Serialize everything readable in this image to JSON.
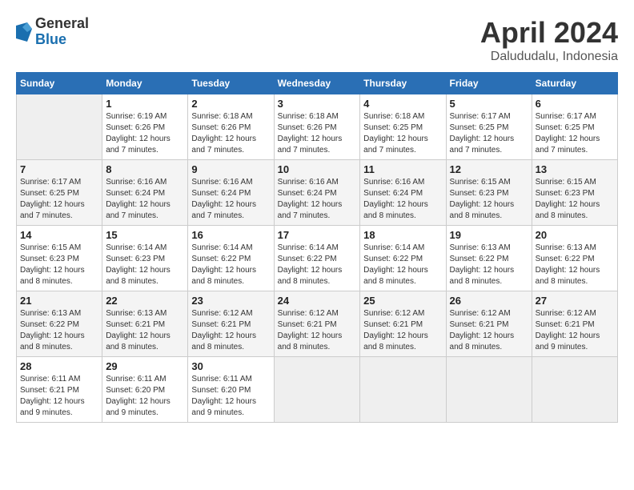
{
  "header": {
    "logo_general": "General",
    "logo_blue": "Blue",
    "title": "April 2024",
    "location": "Dalududalu, Indonesia"
  },
  "columns": [
    "Sunday",
    "Monday",
    "Tuesday",
    "Wednesday",
    "Thursday",
    "Friday",
    "Saturday"
  ],
  "weeks": [
    [
      {
        "day": "",
        "empty": true
      },
      {
        "day": "1",
        "sunrise": "6:19 AM",
        "sunset": "6:26 PM",
        "daylight": "12 hours and 7 minutes."
      },
      {
        "day": "2",
        "sunrise": "6:18 AM",
        "sunset": "6:26 PM",
        "daylight": "12 hours and 7 minutes."
      },
      {
        "day": "3",
        "sunrise": "6:18 AM",
        "sunset": "6:26 PM",
        "daylight": "12 hours and 7 minutes."
      },
      {
        "day": "4",
        "sunrise": "6:18 AM",
        "sunset": "6:25 PM",
        "daylight": "12 hours and 7 minutes."
      },
      {
        "day": "5",
        "sunrise": "6:17 AM",
        "sunset": "6:25 PM",
        "daylight": "12 hours and 7 minutes."
      },
      {
        "day": "6",
        "sunrise": "6:17 AM",
        "sunset": "6:25 PM",
        "daylight": "12 hours and 7 minutes."
      }
    ],
    [
      {
        "day": "7",
        "sunrise": "6:17 AM",
        "sunset": "6:25 PM",
        "daylight": "12 hours and 7 minutes."
      },
      {
        "day": "8",
        "sunrise": "6:16 AM",
        "sunset": "6:24 PM",
        "daylight": "12 hours and 7 minutes."
      },
      {
        "day": "9",
        "sunrise": "6:16 AM",
        "sunset": "6:24 PM",
        "daylight": "12 hours and 7 minutes."
      },
      {
        "day": "10",
        "sunrise": "6:16 AM",
        "sunset": "6:24 PM",
        "daylight": "12 hours and 7 minutes."
      },
      {
        "day": "11",
        "sunrise": "6:16 AM",
        "sunset": "6:24 PM",
        "daylight": "12 hours and 8 minutes."
      },
      {
        "day": "12",
        "sunrise": "6:15 AM",
        "sunset": "6:23 PM",
        "daylight": "12 hours and 8 minutes."
      },
      {
        "day": "13",
        "sunrise": "6:15 AM",
        "sunset": "6:23 PM",
        "daylight": "12 hours and 8 minutes."
      }
    ],
    [
      {
        "day": "14",
        "sunrise": "6:15 AM",
        "sunset": "6:23 PM",
        "daylight": "12 hours and 8 minutes."
      },
      {
        "day": "15",
        "sunrise": "6:14 AM",
        "sunset": "6:23 PM",
        "daylight": "12 hours and 8 minutes."
      },
      {
        "day": "16",
        "sunrise": "6:14 AM",
        "sunset": "6:22 PM",
        "daylight": "12 hours and 8 minutes."
      },
      {
        "day": "17",
        "sunrise": "6:14 AM",
        "sunset": "6:22 PM",
        "daylight": "12 hours and 8 minutes."
      },
      {
        "day": "18",
        "sunrise": "6:14 AM",
        "sunset": "6:22 PM",
        "daylight": "12 hours and 8 minutes."
      },
      {
        "day": "19",
        "sunrise": "6:13 AM",
        "sunset": "6:22 PM",
        "daylight": "12 hours and 8 minutes."
      },
      {
        "day": "20",
        "sunrise": "6:13 AM",
        "sunset": "6:22 PM",
        "daylight": "12 hours and 8 minutes."
      }
    ],
    [
      {
        "day": "21",
        "sunrise": "6:13 AM",
        "sunset": "6:22 PM",
        "daylight": "12 hours and 8 minutes."
      },
      {
        "day": "22",
        "sunrise": "6:13 AM",
        "sunset": "6:21 PM",
        "daylight": "12 hours and 8 minutes."
      },
      {
        "day": "23",
        "sunrise": "6:12 AM",
        "sunset": "6:21 PM",
        "daylight": "12 hours and 8 minutes."
      },
      {
        "day": "24",
        "sunrise": "6:12 AM",
        "sunset": "6:21 PM",
        "daylight": "12 hours and 8 minutes."
      },
      {
        "day": "25",
        "sunrise": "6:12 AM",
        "sunset": "6:21 PM",
        "daylight": "12 hours and 8 minutes."
      },
      {
        "day": "26",
        "sunrise": "6:12 AM",
        "sunset": "6:21 PM",
        "daylight": "12 hours and 8 minutes."
      },
      {
        "day": "27",
        "sunrise": "6:12 AM",
        "sunset": "6:21 PM",
        "daylight": "12 hours and 9 minutes."
      }
    ],
    [
      {
        "day": "28",
        "sunrise": "6:11 AM",
        "sunset": "6:21 PM",
        "daylight": "12 hours and 9 minutes."
      },
      {
        "day": "29",
        "sunrise": "6:11 AM",
        "sunset": "6:20 PM",
        "daylight": "12 hours and 9 minutes."
      },
      {
        "day": "30",
        "sunrise": "6:11 AM",
        "sunset": "6:20 PM",
        "daylight": "12 hours and 9 minutes."
      },
      {
        "day": "",
        "empty": true
      },
      {
        "day": "",
        "empty": true
      },
      {
        "day": "",
        "empty": true
      },
      {
        "day": "",
        "empty": true
      }
    ]
  ]
}
